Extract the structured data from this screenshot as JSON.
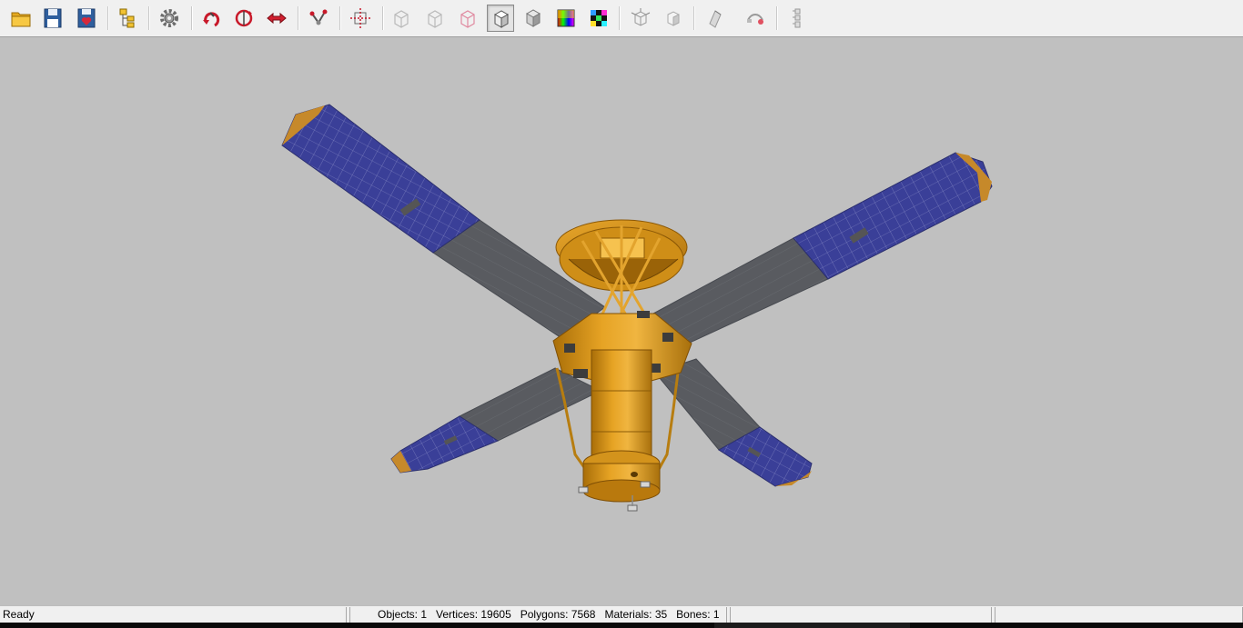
{
  "toolbar": {
    "buttons": [
      {
        "name": "open-file-button",
        "icon": "folder-icon"
      },
      {
        "name": "save-button",
        "icon": "floppy-disk-icon"
      },
      {
        "name": "save-as-button",
        "icon": "floppy-heart-icon"
      },
      {
        "name": "hierarchy-button",
        "icon": "tree-hierarchy-icon"
      },
      {
        "name": "settings-button",
        "icon": "gear-icon"
      },
      {
        "name": "rotate-button",
        "icon": "rotate-arrow-icon"
      },
      {
        "name": "orbit-button",
        "icon": "orbit-circle-icon"
      },
      {
        "name": "pan-button",
        "icon": "pan-arrow-icon"
      },
      {
        "name": "bones-button",
        "icon": "bone-joint-icon"
      },
      {
        "name": "center-view-button",
        "icon": "center-cross-icon"
      },
      {
        "name": "wireframe-light-button",
        "icon": "wireframe-cube-icon"
      },
      {
        "name": "wireframe-gray-button",
        "icon": "wireframe-cube-icon"
      },
      {
        "name": "wireframe-color-button",
        "icon": "wireframe-cube-pink-icon"
      },
      {
        "name": "flat-shading-button",
        "icon": "solid-cube-white-icon"
      },
      {
        "name": "smooth-shading-button",
        "icon": "solid-cube-gray-icon"
      },
      {
        "name": "material-shading-button",
        "icon": "color-spectrum-cube-icon"
      },
      {
        "name": "texture-button",
        "icon": "checker-cube-icon"
      },
      {
        "name": "normals-button",
        "icon": "cube-normals-icon"
      },
      {
        "name": "backface-button",
        "icon": "cube-face-icon"
      },
      {
        "name": "lighting-button",
        "icon": "light-icon"
      },
      {
        "name": "camera-button",
        "icon": "camera-path-icon"
      },
      {
        "name": "skeleton-button",
        "icon": "skeleton-chain-icon"
      }
    ],
    "pressed_button": "flat-shading-button"
  },
  "status": {
    "ready": "Ready",
    "stats": "Objects: 1   Vertices: 19605   Polygons: 7568   Materials: 35   Bones: 1",
    "pane3": "",
    "pane4": ""
  },
  "colors": {
    "viewport_bg": "#c0c0c0",
    "solar_cell": "#3a3f98",
    "hinge_panel": "#595b60",
    "body_gold": "#c88a12",
    "body_highlight": "#f2c15a"
  }
}
